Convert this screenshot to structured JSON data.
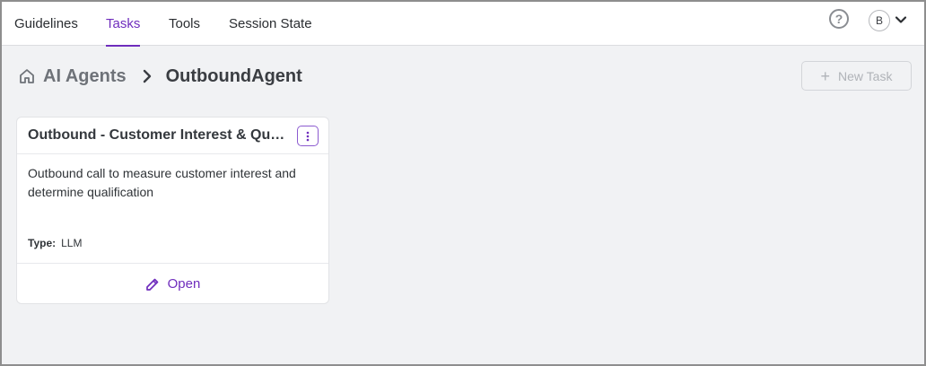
{
  "nav": {
    "tabs": [
      {
        "label": "Guidelines"
      },
      {
        "label": "Tasks",
        "active": true
      },
      {
        "label": "Tools"
      },
      {
        "label": "Session State"
      }
    ],
    "help_glyph": "?",
    "avatar_initial": "B",
    "icons": {
      "help": "help-circle-icon",
      "avatar_menu": "chevron-down-icon"
    }
  },
  "breadcrumb": {
    "parent": "AI Agents",
    "current": "OutboundAgent",
    "icons": {
      "home": "home-icon",
      "separator": "chevron-right-icon"
    }
  },
  "toolbar": {
    "new_task_label": "New Task",
    "new_task_icon": "+",
    "new_task_disabled": true
  },
  "task_card": {
    "title": "Outbound - Customer Interest & Qualification",
    "description": "Outbound call to measure customer interest and determine qualification",
    "type_label": "Type:",
    "type_value": "LLM",
    "open_label": "Open",
    "icons": {
      "menu": "kebab-menu-icon",
      "open": "pencil-icon"
    }
  },
  "colors": {
    "accent": "#6f2dbd",
    "background": "#f1f2f4",
    "card": "#ffffff",
    "text": "#2f3337",
    "muted": "#6e7278"
  }
}
